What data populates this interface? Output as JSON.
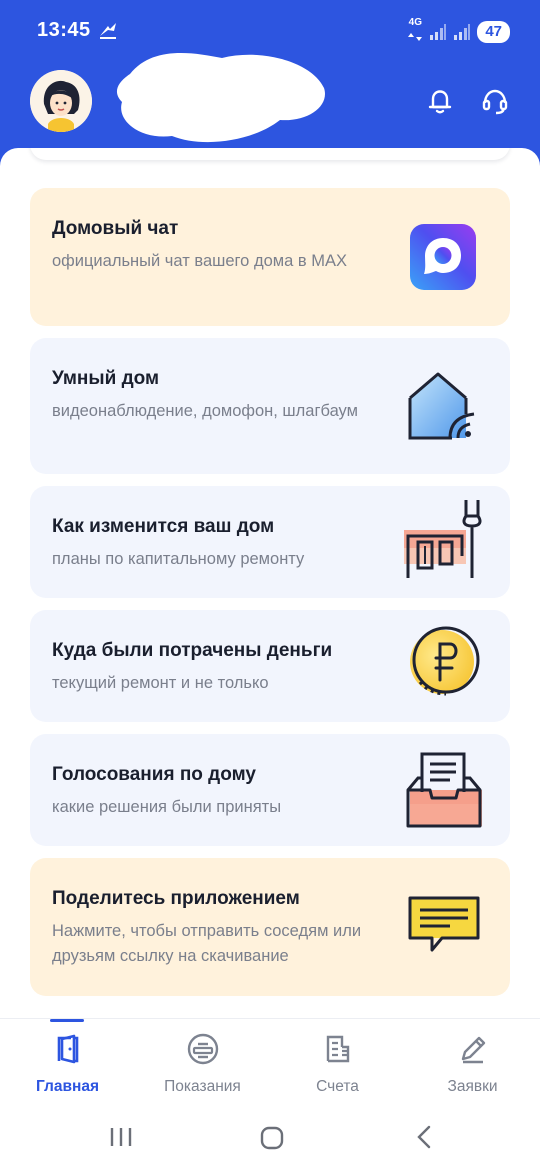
{
  "status_bar": {
    "time": "13:45",
    "network": "4G",
    "battery": "47"
  },
  "header": {
    "avatar_icon": "user-avatar-girl",
    "bell_icon": "bell-icon",
    "support_icon": "headset-icon",
    "brand_color": "#2d55e0"
  },
  "cards": [
    {
      "title": "Домовый чат",
      "subtitle": "официальный чат вашего дома в MAX",
      "icon": "max-messenger-icon",
      "style": "warm"
    },
    {
      "title": "Умный дом",
      "subtitle": "видеонаблюдение, домофон, шлагбаум",
      "icon": "smart-home-icon",
      "style": "cool"
    },
    {
      "title": "Как изменится ваш дом",
      "subtitle": "планы по капитальному ремонту",
      "icon": "renovation-icon",
      "style": "cool"
    },
    {
      "title": "Куда были потрачены деньги",
      "subtitle": "текущий ремонт и не только",
      "icon": "ruble-coin-icon",
      "style": "cool"
    },
    {
      "title": "Голосования по дому",
      "subtitle": "какие решения были приняты",
      "icon": "ballot-box-icon",
      "style": "cool"
    },
    {
      "title": "Поделитесь приложением",
      "subtitle": "Нажмите, чтобы отправить соседям или друзьям ссылку на скачивание",
      "icon": "message-bubble-icon",
      "style": "warm"
    }
  ],
  "bottom_nav": [
    {
      "label": "Главная",
      "icon": "door-icon",
      "active": true
    },
    {
      "label": "Показания",
      "icon": "meter-icon",
      "active": false
    },
    {
      "label": "Счета",
      "icon": "receipt-icon",
      "active": false
    },
    {
      "label": "Заявки",
      "icon": "pencil-icon",
      "active": false
    }
  ]
}
